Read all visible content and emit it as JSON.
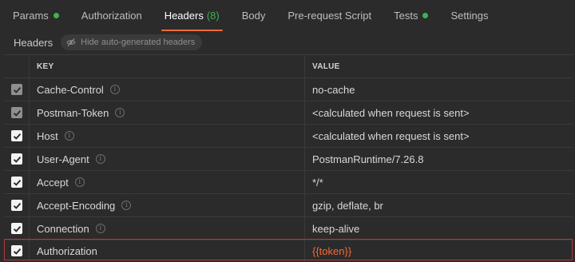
{
  "tabs": [
    {
      "label": "Params",
      "indicator": "dot"
    },
    {
      "label": "Authorization"
    },
    {
      "label": "Headers",
      "count": "(8)",
      "active": true
    },
    {
      "label": "Body"
    },
    {
      "label": "Pre-request Script"
    },
    {
      "label": "Tests",
      "indicator": "dot"
    },
    {
      "label": "Settings"
    }
  ],
  "subheader": {
    "title": "Headers",
    "toggle_label": "Hide auto-generated headers",
    "toggle_icon": "eye-off-icon"
  },
  "table": {
    "columns": {
      "key": "KEY",
      "value": "VALUE"
    },
    "rows": [
      {
        "key": "Cache-Control",
        "value": "no-cache",
        "checked": true,
        "locked": true,
        "info": true
      },
      {
        "key": "Postman-Token",
        "value": "<calculated when request is sent>",
        "checked": true,
        "locked": true,
        "info": true
      },
      {
        "key": "Host",
        "value": "<calculated when request is sent>",
        "checked": true,
        "locked": false,
        "info": true
      },
      {
        "key": "User-Agent",
        "value": "PostmanRuntime/7.26.8",
        "checked": true,
        "locked": false,
        "info": true
      },
      {
        "key": "Accept",
        "value": "*/*",
        "checked": true,
        "locked": false,
        "info": true
      },
      {
        "key": "Accept-Encoding",
        "value": "gzip, deflate, br",
        "checked": true,
        "locked": false,
        "info": true
      },
      {
        "key": "Connection",
        "value": "keep-alive",
        "checked": true,
        "locked": false,
        "info": true
      },
      {
        "key": "Authorization",
        "value": "{{token}}",
        "checked": true,
        "locked": false,
        "info": false,
        "variable": true,
        "highlighted": true
      }
    ]
  },
  "colors": {
    "accent": "#f26b3a",
    "status_green": "#3fb34f",
    "highlight_border": "#b23a3a",
    "background": "#2b2b2b"
  }
}
